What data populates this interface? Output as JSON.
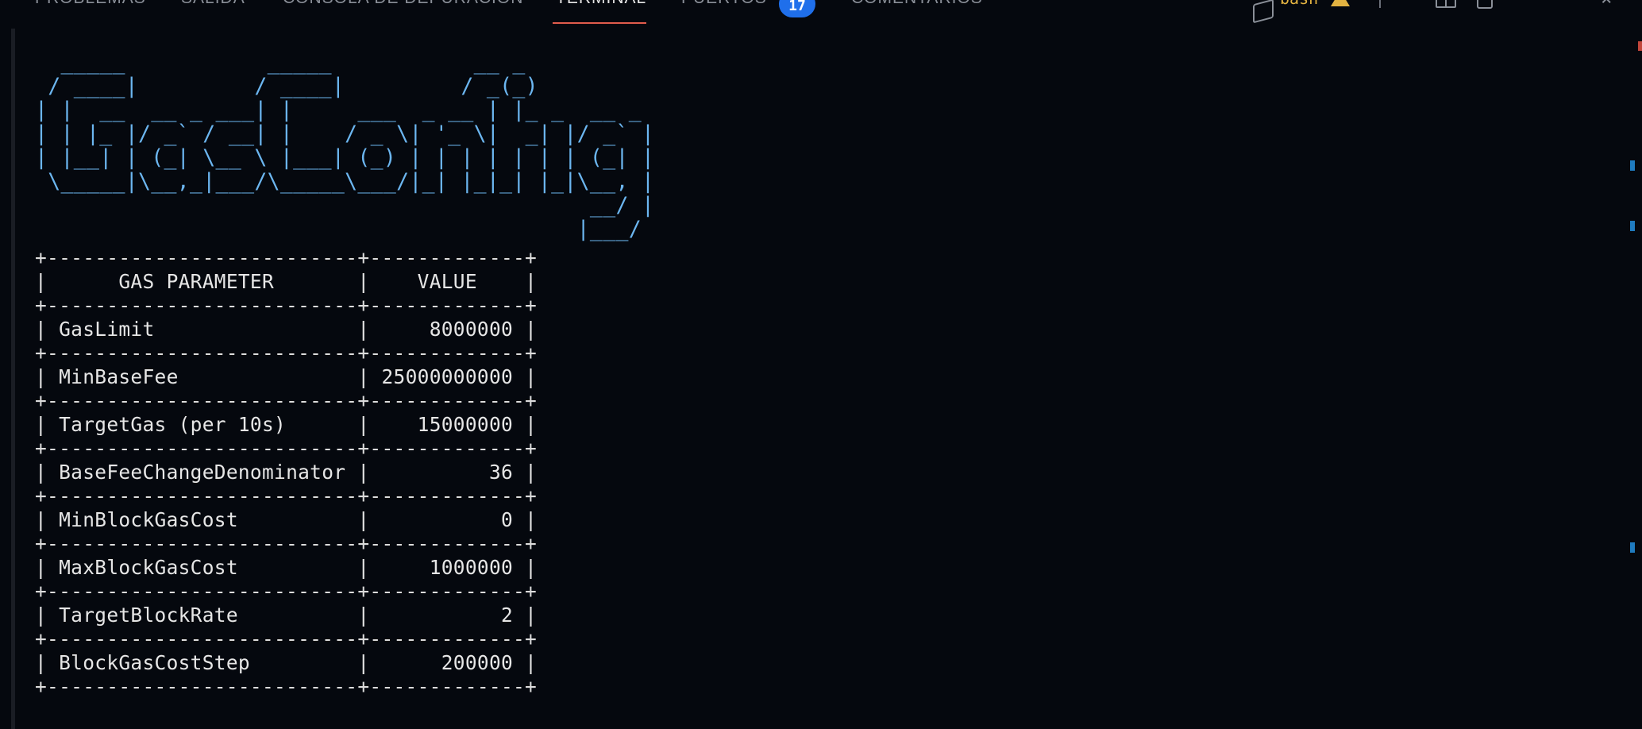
{
  "panel": {
    "tabs": [
      {
        "label": "PROBLEMAS"
      },
      {
        "label": "SALIDA"
      },
      {
        "label": "CONSOLA DE DEPURACIÓN"
      },
      {
        "label": "TERMINAL"
      },
      {
        "label": "PUERTOS"
      },
      {
        "label": "COMENTARIOS"
      }
    ],
    "active_tab": "TERMINAL",
    "ports_badge": "17",
    "shell_name": "bash",
    "icons": [
      "shell-icon",
      "warning-icon",
      "split-terminal-icon",
      "trash-icon",
      "more-actions-icon",
      "close-icon"
    ],
    "colors": {
      "accent": "#e25c4c",
      "badge": "#1f6feb",
      "banner": "#6cb6f0",
      "warning": "#e3b341"
    }
  },
  "terminal": {
    "banner_lines": [
      "  _____           _____           __ _",
      " / ____|         / ____|         / _(_)",
      "| |  __  __ _ ___| |     ___  _ __ | |_ _  __ _",
      "| | |_ |/ _` / __| |    / _ \\| '_ \\|  _| |/ _` |",
      "| |__| | (_| \\__ \\ |___| (_) | | | | | | | (_| |",
      " \\_____|\\__,_|___/\\_____\\___/|_| |_|_| |_|\\__, |",
      "                                           __/ |",
      "                                          |___/"
    ],
    "table": {
      "headers": [
        "GAS PARAMETER",
        "VALUE"
      ],
      "rows": [
        [
          "GasLimit",
          "8000000"
        ],
        [
          "MinBaseFee",
          "25000000000"
        ],
        [
          "TargetGas (per 10s)",
          "15000000"
        ],
        [
          "BaseFeeChangeDenominator",
          "36"
        ],
        [
          "MinBlockGasCost",
          "0"
        ],
        [
          "MaxBlockGasCost",
          "1000000"
        ],
        [
          "TargetBlockRate",
          "2"
        ],
        [
          "BlockGasCostStep",
          "200000"
        ]
      ]
    }
  }
}
